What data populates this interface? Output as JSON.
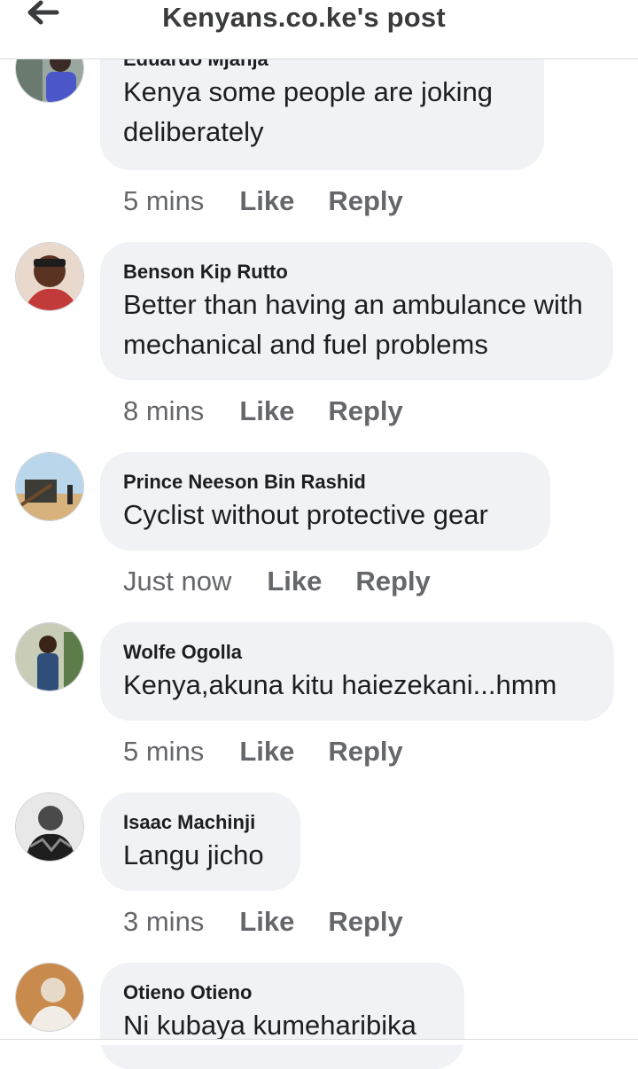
{
  "header": {
    "title": "Kenyans.co.ke's post",
    "back_icon": "arrow-left-icon"
  },
  "colors": {
    "bubble": "#f0f2f5",
    "meta": "#65676b",
    "text": "#1c1e21"
  },
  "comments": [
    {
      "author": "Eduardo Mjanja",
      "text": "Kenya some people are joking deliberately",
      "time": "5 mins",
      "like": "Like",
      "reply": "Reply"
    },
    {
      "author": "Benson Kip Rutto",
      "text": "Better than having an ambulance with mechanical and fuel problems",
      "time": "8 mins",
      "like": "Like",
      "reply": "Reply"
    },
    {
      "author": "Prince Neeson Bin Rashid",
      "text": "Cyclist without protective gear",
      "time": "Just now",
      "like": "Like",
      "reply": "Reply"
    },
    {
      "author": "Wolfe Ogolla",
      "text": "Kenya,akuna kitu haiezekani...hmm",
      "time": "5 mins",
      "like": "Like",
      "reply": "Reply"
    },
    {
      "author": "Isaac Machinji",
      "text": "Langu jicho",
      "time": "3 mins",
      "like": "Like",
      "reply": "Reply"
    },
    {
      "author": "Otieno Otieno",
      "text": "Ni kubaya kumeharibika",
      "time": "",
      "like": "",
      "reply": ""
    }
  ]
}
